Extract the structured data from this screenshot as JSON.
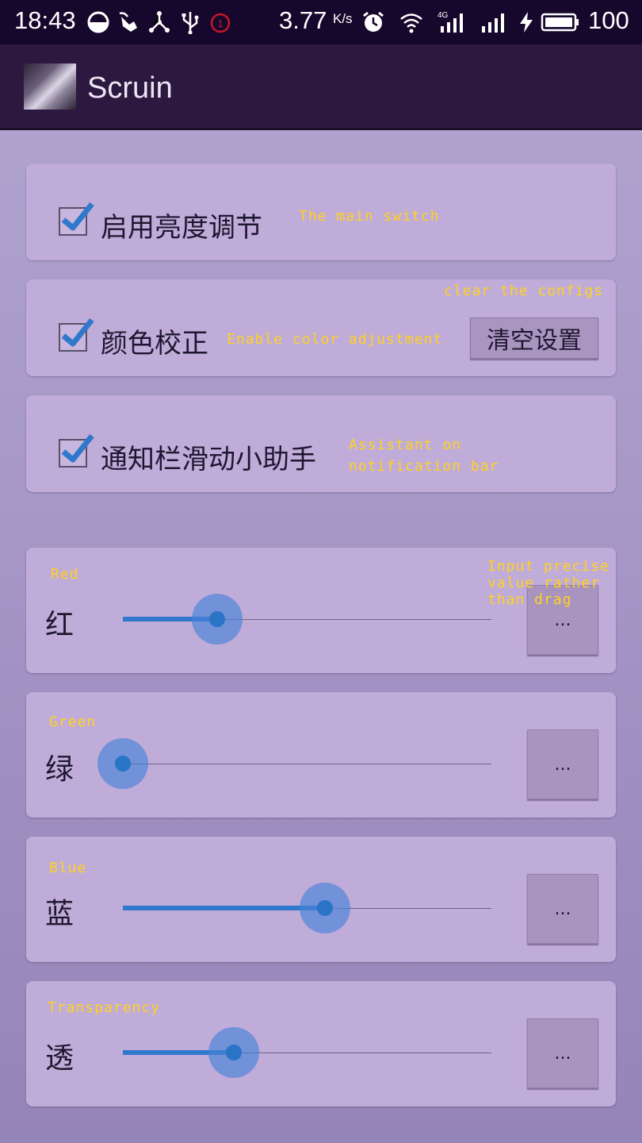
{
  "status_bar": {
    "time": "18:43",
    "speed_value": "3.77",
    "speed_unit": "K/s",
    "battery_percent": "100",
    "icons": [
      "half-circle-icon",
      "pointer-hand-icon",
      "share-icon",
      "usb-icon",
      "alarm-badge-icon",
      "alarm-clock-icon",
      "wifi-icon",
      "signal-4g-icon",
      "signal-icon",
      "charging-bolt-icon",
      "battery-icon"
    ],
    "alarm_badge_text": "1",
    "network_type": "4G"
  },
  "app_bar": {
    "title": "Scruin"
  },
  "switches": [
    {
      "label": "启用亮度调节",
      "annotation": "The main switch",
      "checked": true
    },
    {
      "label": "颜色校正",
      "annotation": "Enable color adjustment",
      "checked": true,
      "button_label": "清空设置",
      "button_annotation": "clear the configs"
    },
    {
      "label": "通知栏滑动小助手",
      "annotation_line1": "Assistant on",
      "annotation_line2": "notification bar",
      "checked": true
    }
  ],
  "sliders": [
    {
      "label": "红",
      "annotation": "Red",
      "fraction": 0.255,
      "button_label": "...",
      "button_annotation_line1": "Input precise",
      "button_annotation_line2": "value rather",
      "button_annotation_line3": "than drag"
    },
    {
      "label": "绿",
      "annotation": "Green",
      "fraction": 0.0,
      "button_label": "..."
    },
    {
      "label": "蓝",
      "annotation": "Blue",
      "fraction": 0.548,
      "button_label": "..."
    },
    {
      "label": "透",
      "annotation": "Transparency",
      "fraction": 0.301,
      "button_label": "..."
    }
  ],
  "colors": {
    "accent": "#2f78cc",
    "card": "#c0acd9",
    "annotation": "#ffd21e",
    "app_bar": "#2d1840",
    "status_bar": "#16082c"
  }
}
